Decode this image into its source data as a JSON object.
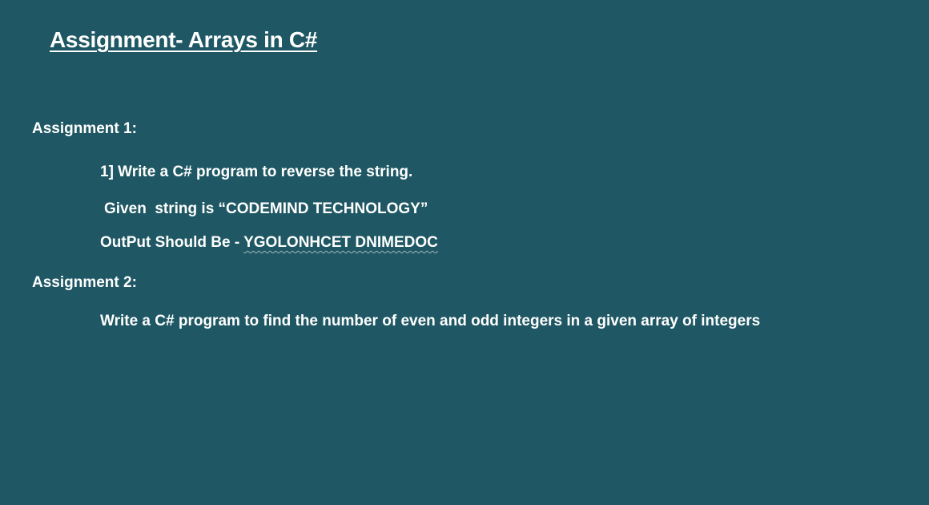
{
  "title": "Assignment- Arrays in C#",
  "assignment1": {
    "heading": "Assignment 1:",
    "task": "1] Write a C# program to reverse the string.",
    "given": "Given  string is “CODEMIND TECHNOLOGY”",
    "output_label": "OutPut Should Be - ",
    "output_value": "YGOLONHCET DNIMEDOC"
  },
  "assignment2": {
    "heading": "Assignment 2:",
    "task": "Write a C# program to find the number of even and odd integers in a given array of integers"
  },
  "colors": {
    "background": "#1f5864",
    "text": "#ffffff"
  }
}
